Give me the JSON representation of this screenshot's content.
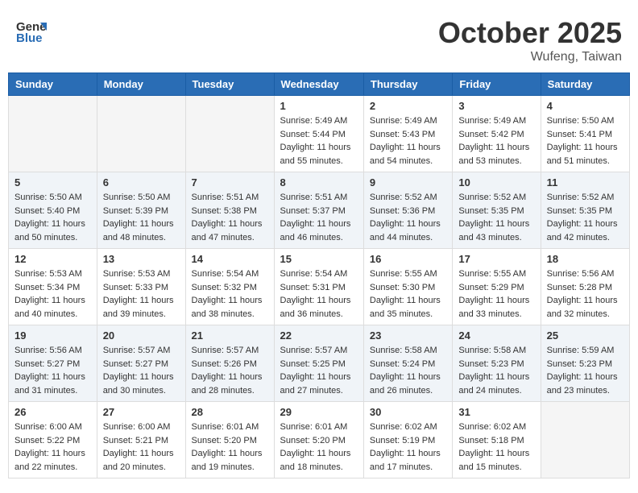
{
  "header": {
    "logo_general": "General",
    "logo_blue": "Blue",
    "month": "October 2025",
    "location": "Wufeng, Taiwan"
  },
  "days_of_week": [
    "Sunday",
    "Monday",
    "Tuesday",
    "Wednesday",
    "Thursday",
    "Friday",
    "Saturday"
  ],
  "weeks": [
    {
      "shaded": false,
      "days": [
        {
          "number": "",
          "info": ""
        },
        {
          "number": "",
          "info": ""
        },
        {
          "number": "",
          "info": ""
        },
        {
          "number": "1",
          "info": "Sunrise: 5:49 AM\nSunset: 5:44 PM\nDaylight: 11 hours\nand 55 minutes."
        },
        {
          "number": "2",
          "info": "Sunrise: 5:49 AM\nSunset: 5:43 PM\nDaylight: 11 hours\nand 54 minutes."
        },
        {
          "number": "3",
          "info": "Sunrise: 5:49 AM\nSunset: 5:42 PM\nDaylight: 11 hours\nand 53 minutes."
        },
        {
          "number": "4",
          "info": "Sunrise: 5:50 AM\nSunset: 5:41 PM\nDaylight: 11 hours\nand 51 minutes."
        }
      ]
    },
    {
      "shaded": true,
      "days": [
        {
          "number": "5",
          "info": "Sunrise: 5:50 AM\nSunset: 5:40 PM\nDaylight: 11 hours\nand 50 minutes."
        },
        {
          "number": "6",
          "info": "Sunrise: 5:50 AM\nSunset: 5:39 PM\nDaylight: 11 hours\nand 48 minutes."
        },
        {
          "number": "7",
          "info": "Sunrise: 5:51 AM\nSunset: 5:38 PM\nDaylight: 11 hours\nand 47 minutes."
        },
        {
          "number": "8",
          "info": "Sunrise: 5:51 AM\nSunset: 5:37 PM\nDaylight: 11 hours\nand 46 minutes."
        },
        {
          "number": "9",
          "info": "Sunrise: 5:52 AM\nSunset: 5:36 PM\nDaylight: 11 hours\nand 44 minutes."
        },
        {
          "number": "10",
          "info": "Sunrise: 5:52 AM\nSunset: 5:35 PM\nDaylight: 11 hours\nand 43 minutes."
        },
        {
          "number": "11",
          "info": "Sunrise: 5:52 AM\nSunset: 5:35 PM\nDaylight: 11 hours\nand 42 minutes."
        }
      ]
    },
    {
      "shaded": false,
      "days": [
        {
          "number": "12",
          "info": "Sunrise: 5:53 AM\nSunset: 5:34 PM\nDaylight: 11 hours\nand 40 minutes."
        },
        {
          "number": "13",
          "info": "Sunrise: 5:53 AM\nSunset: 5:33 PM\nDaylight: 11 hours\nand 39 minutes."
        },
        {
          "number": "14",
          "info": "Sunrise: 5:54 AM\nSunset: 5:32 PM\nDaylight: 11 hours\nand 38 minutes."
        },
        {
          "number": "15",
          "info": "Sunrise: 5:54 AM\nSunset: 5:31 PM\nDaylight: 11 hours\nand 36 minutes."
        },
        {
          "number": "16",
          "info": "Sunrise: 5:55 AM\nSunset: 5:30 PM\nDaylight: 11 hours\nand 35 minutes."
        },
        {
          "number": "17",
          "info": "Sunrise: 5:55 AM\nSunset: 5:29 PM\nDaylight: 11 hours\nand 33 minutes."
        },
        {
          "number": "18",
          "info": "Sunrise: 5:56 AM\nSunset: 5:28 PM\nDaylight: 11 hours\nand 32 minutes."
        }
      ]
    },
    {
      "shaded": true,
      "days": [
        {
          "number": "19",
          "info": "Sunrise: 5:56 AM\nSunset: 5:27 PM\nDaylight: 11 hours\nand 31 minutes."
        },
        {
          "number": "20",
          "info": "Sunrise: 5:57 AM\nSunset: 5:27 PM\nDaylight: 11 hours\nand 30 minutes."
        },
        {
          "number": "21",
          "info": "Sunrise: 5:57 AM\nSunset: 5:26 PM\nDaylight: 11 hours\nand 28 minutes."
        },
        {
          "number": "22",
          "info": "Sunrise: 5:57 AM\nSunset: 5:25 PM\nDaylight: 11 hours\nand 27 minutes."
        },
        {
          "number": "23",
          "info": "Sunrise: 5:58 AM\nSunset: 5:24 PM\nDaylight: 11 hours\nand 26 minutes."
        },
        {
          "number": "24",
          "info": "Sunrise: 5:58 AM\nSunset: 5:23 PM\nDaylight: 11 hours\nand 24 minutes."
        },
        {
          "number": "25",
          "info": "Sunrise: 5:59 AM\nSunset: 5:23 PM\nDaylight: 11 hours\nand 23 minutes."
        }
      ]
    },
    {
      "shaded": false,
      "days": [
        {
          "number": "26",
          "info": "Sunrise: 6:00 AM\nSunset: 5:22 PM\nDaylight: 11 hours\nand 22 minutes."
        },
        {
          "number": "27",
          "info": "Sunrise: 6:00 AM\nSunset: 5:21 PM\nDaylight: 11 hours\nand 20 minutes."
        },
        {
          "number": "28",
          "info": "Sunrise: 6:01 AM\nSunset: 5:20 PM\nDaylight: 11 hours\nand 19 minutes."
        },
        {
          "number": "29",
          "info": "Sunrise: 6:01 AM\nSunset: 5:20 PM\nDaylight: 11 hours\nand 18 minutes."
        },
        {
          "number": "30",
          "info": "Sunrise: 6:02 AM\nSunset: 5:19 PM\nDaylight: 11 hours\nand 17 minutes."
        },
        {
          "number": "31",
          "info": "Sunrise: 6:02 AM\nSunset: 5:18 PM\nDaylight: 11 hours\nand 15 minutes."
        },
        {
          "number": "",
          "info": ""
        }
      ]
    }
  ]
}
